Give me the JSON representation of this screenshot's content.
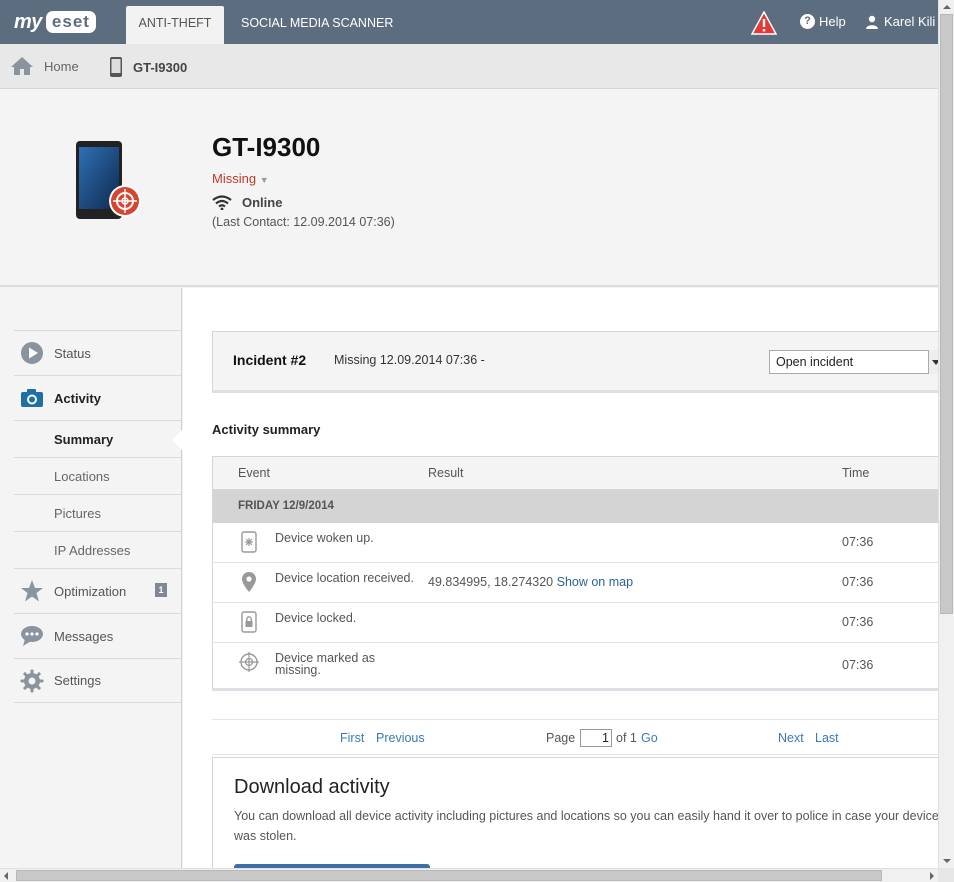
{
  "header": {
    "logo_my": "my",
    "logo_eset": "eset",
    "tabs": [
      {
        "label": "ANTI-THEFT",
        "active": true
      },
      {
        "label": "SOCIAL MEDIA SCANNER",
        "active": false
      }
    ],
    "warning_icon": "warning-triangle-icon",
    "help_label": "Help",
    "user_name": "Karel Kili"
  },
  "breadcrumb": {
    "home_label": "Home",
    "device_label": "GT-I9300"
  },
  "device": {
    "name": "GT-I9300",
    "status": "Missing",
    "connection": "Online",
    "last_contact": "(Last Contact: 12.09.2014 07:36)"
  },
  "sidebar": {
    "items": [
      {
        "label": "Status",
        "icon": "play-circle-icon"
      },
      {
        "label": "Activity",
        "icon": "camera-icon"
      },
      {
        "label": "Optimization",
        "icon": "star-icon",
        "badge": "1"
      },
      {
        "label": "Messages",
        "icon": "chat-bubble-icon"
      },
      {
        "label": "Settings",
        "icon": "gear-icon"
      }
    ],
    "activity_sub": [
      {
        "label": "Summary",
        "active": true
      },
      {
        "label": "Locations"
      },
      {
        "label": "Pictures"
      },
      {
        "label": "IP Addresses"
      }
    ]
  },
  "incident": {
    "title": "Incident #2",
    "description": "Missing 12.09.2014 07:36 -",
    "select_value": "Open incident"
  },
  "activity": {
    "title": "Activity summary",
    "columns": [
      "Event",
      "Result",
      "Time"
    ],
    "day": "FRIDAY 12/9/2014",
    "rows": [
      {
        "icon": "device-wake-icon",
        "event": "Device woken up.",
        "result": "",
        "link": "",
        "time": "07:36"
      },
      {
        "icon": "location-pin-icon",
        "event": "Device location received.",
        "result": "49.834995, 18.274320",
        "link": "Show on map",
        "time": "07:36"
      },
      {
        "icon": "device-lock-icon",
        "event": "Device locked.",
        "result": "",
        "link": "",
        "time": "07:36"
      },
      {
        "icon": "crosshair-icon",
        "event": "Device marked as missing.",
        "result": "",
        "link": "",
        "time": "07:36"
      }
    ]
  },
  "pager": {
    "first": "First",
    "previous": "Previous",
    "page_label": "Page",
    "page_value": "1",
    "of_label": "of 1",
    "go": "Go",
    "next": "Next",
    "last": "Last"
  },
  "download": {
    "title": "Download activity",
    "text": "You can download all device activity including pictures and locations so you can easily hand it over to police in case your device was stolen."
  },
  "colors": {
    "topbar": "#5c6d80",
    "missing": "#c0392b",
    "link": "#3a7ab8"
  }
}
